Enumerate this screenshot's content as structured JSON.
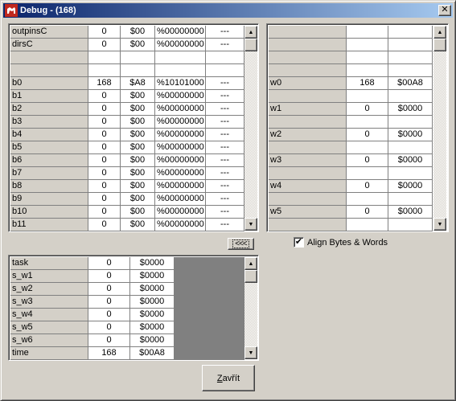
{
  "window": {
    "title": "Debug - (168)",
    "close_glyph": "✕"
  },
  "main_grid": {
    "rows": [
      [
        "outpinsC",
        "0",
        "$00",
        "%00000000",
        "---"
      ],
      [
        "dirsC",
        "0",
        "$00",
        "%00000000",
        "---"
      ],
      [
        "",
        "",
        "",
        "",
        ""
      ],
      [
        "",
        "",
        "",
        "",
        ""
      ],
      [
        "b0",
        "168",
        "$A8",
        "%10101000",
        "---"
      ],
      [
        "b1",
        "0",
        "$00",
        "%00000000",
        "---"
      ],
      [
        "b2",
        "0",
        "$00",
        "%00000000",
        "---"
      ],
      [
        "b3",
        "0",
        "$00",
        "%00000000",
        "---"
      ],
      [
        "b4",
        "0",
        "$00",
        "%00000000",
        "---"
      ],
      [
        "b5",
        "0",
        "$00",
        "%00000000",
        "---"
      ],
      [
        "b6",
        "0",
        "$00",
        "%00000000",
        "---"
      ],
      [
        "b7",
        "0",
        "$00",
        "%00000000",
        "---"
      ],
      [
        "b8",
        "0",
        "$00",
        "%00000000",
        "---"
      ],
      [
        "b9",
        "0",
        "$00",
        "%00000000",
        "---"
      ],
      [
        "b10",
        "0",
        "$00",
        "%00000000",
        "---"
      ],
      [
        "b11",
        "0",
        "$00",
        "%00000000",
        "---"
      ]
    ]
  },
  "word_grid": {
    "rows": [
      [
        "",
        "",
        ""
      ],
      [
        "",
        "",
        ""
      ],
      [
        "",
        "",
        ""
      ],
      [
        "",
        "",
        ""
      ],
      [
        "w0",
        "168",
        "$00A8"
      ],
      [
        "",
        "",
        ""
      ],
      [
        "w1",
        "0",
        "$0000"
      ],
      [
        "",
        "",
        ""
      ],
      [
        "w2",
        "0",
        "$0000"
      ],
      [
        "",
        "",
        ""
      ],
      [
        "w3",
        "0",
        "$0000"
      ],
      [
        "",
        "",
        ""
      ],
      [
        "w4",
        "0",
        "$0000"
      ],
      [
        "",
        "",
        ""
      ],
      [
        "w5",
        "0",
        "$0000"
      ],
      [
        "",
        "",
        ""
      ]
    ]
  },
  "task_grid": {
    "rows": [
      [
        "task",
        "0",
        "$0000"
      ],
      [
        "s_w1",
        "0",
        "$0000"
      ],
      [
        "s_w2",
        "0",
        "$0000"
      ],
      [
        "s_w3",
        "0",
        "$0000"
      ],
      [
        "s_w4",
        "0",
        "$0000"
      ],
      [
        "s_w5",
        "0",
        "$0000"
      ],
      [
        "s_w6",
        "0",
        "$0000"
      ],
      [
        "time",
        "168",
        "$00A8"
      ]
    ]
  },
  "controls": {
    "collapse_button_label": "<<<",
    "align_checkbox_label": "Align Bytes & Words",
    "align_checked_glyph": "✔",
    "close_button_label": "Zavřít"
  },
  "icons": {
    "scroll_up": "▲",
    "scroll_down": "▼"
  },
  "colors": {
    "title_start": "#0a246a",
    "title_end": "#a6caf0",
    "face": "#d4d0c8",
    "grid_dark": "#808080"
  }
}
